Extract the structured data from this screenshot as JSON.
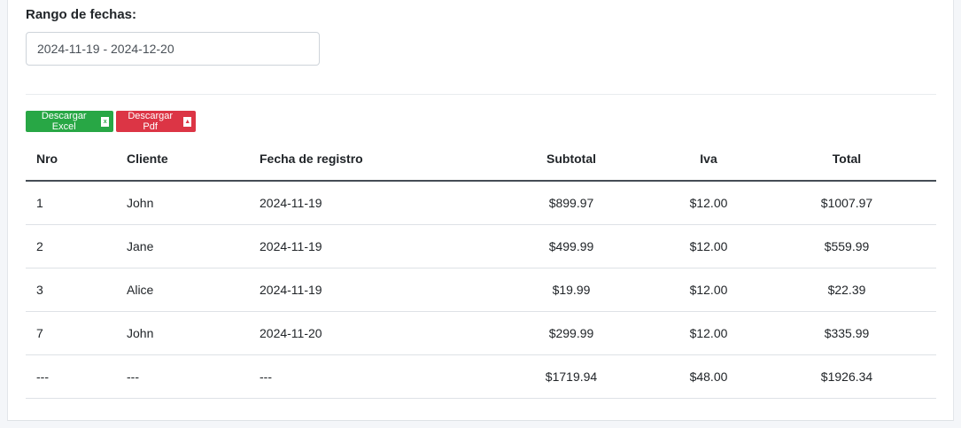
{
  "filter": {
    "label": "Rango de fechas:",
    "value": "2024-11-19 - 2024-12-20"
  },
  "actions": {
    "excel_label": "Descargar Excel",
    "excel_icon": "excel-file-icon",
    "pdf_label": "Descargar Pdf",
    "pdf_icon": "pdf-file-icon",
    "excel_color": "#28a745",
    "pdf_color": "#dc3545"
  },
  "table": {
    "headers": [
      "Nro",
      "Cliente",
      "Fecha de registro",
      "Subtotal",
      "Iva",
      "Total"
    ],
    "rows": [
      [
        "1",
        "John",
        "2024-11-19",
        "$899.97",
        "$12.00",
        "$1007.97"
      ],
      [
        "2",
        "Jane",
        "2024-11-19",
        "$499.99",
        "$12.00",
        "$559.99"
      ],
      [
        "3",
        "Alice",
        "2024-11-19",
        "$19.99",
        "$12.00",
        "$22.39"
      ],
      [
        "7",
        "John",
        "2024-11-20",
        "$299.99",
        "$12.00",
        "$335.99"
      ],
      [
        "---",
        "---",
        "---",
        "$1719.94",
        "$48.00",
        "$1926.34"
      ]
    ]
  }
}
